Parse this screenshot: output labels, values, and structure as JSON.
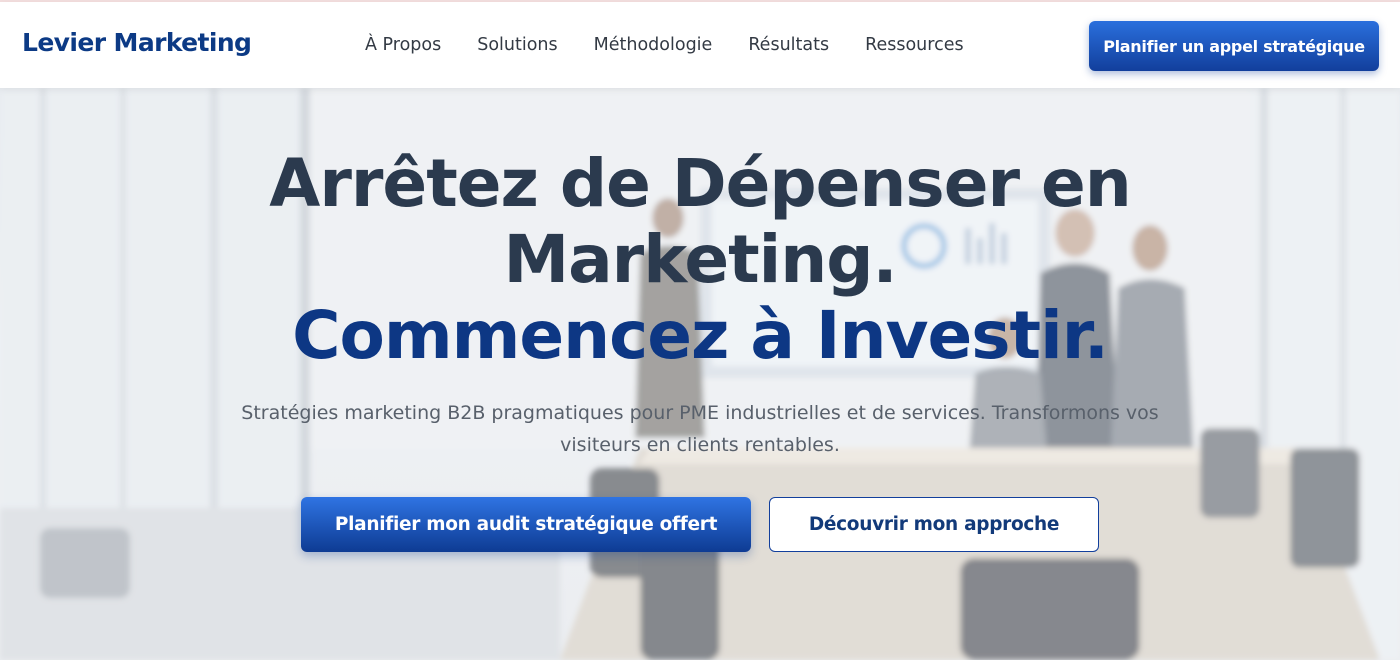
{
  "header": {
    "logo": "Levier Marketing",
    "nav": [
      "À Propos",
      "Solutions",
      "Méthodologie",
      "Résultats",
      "Ressources"
    ],
    "cta_label": "Planifier un appel stratégique"
  },
  "hero": {
    "headline_line1": "Arrêtez de Dépenser en",
    "headline_line2": "Marketing.",
    "headline_line3": "Commencez à Investir.",
    "subtitle": "Stratégies marketing B2B pragmatiques pour PME industrielles et de services. Transformons vos visiteurs en clients rentables.",
    "primary_cta": "Planifier mon audit stratégique offert",
    "secondary_cta": "Découvrir mon approche"
  },
  "colors": {
    "brand": "#0c3a85",
    "accent": "#2a6fdd",
    "headline_dark": "#2b3a4e",
    "headline_blue": "#0d3784"
  }
}
